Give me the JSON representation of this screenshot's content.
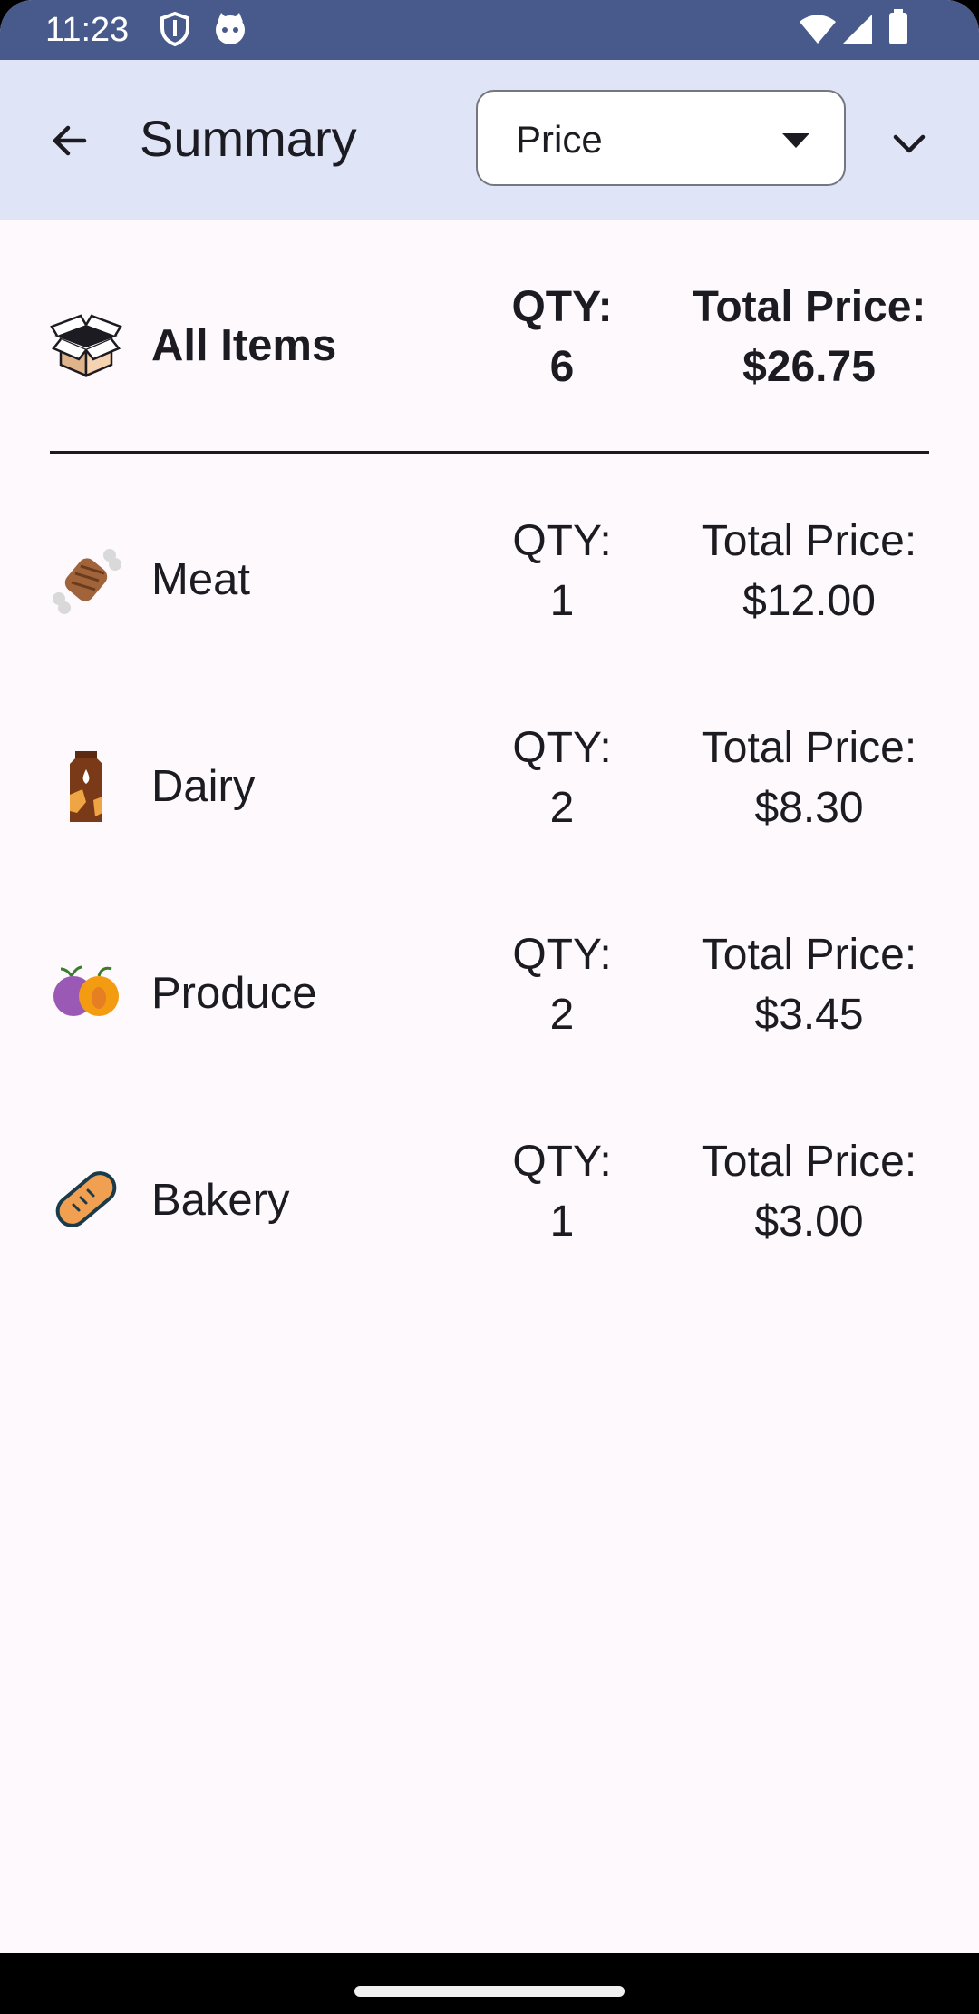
{
  "status_bar": {
    "time": "11:23",
    "icons": [
      "shield-icon",
      "cat-icon",
      "wifi-icon",
      "signal-icon",
      "battery-icon"
    ]
  },
  "app_bar": {
    "back_icon": "arrow-left-icon",
    "title": "Summary",
    "sort_dropdown": {
      "selected": "Price",
      "caret_icon": "caret-down-icon"
    },
    "expand_icon": "chevron-down-icon"
  },
  "summary": {
    "all_items": {
      "icon": "open-box-icon",
      "name": "All Items",
      "qty_label": "QTY:",
      "qty_value": "6",
      "price_label": "Total Price:",
      "price_value": "$26.75"
    },
    "categories": [
      {
        "icon": "meat-icon",
        "name": "Meat",
        "qty_label": "QTY:",
        "qty_value": "1",
        "price_label": "Total Price:",
        "price_value": "$12.00"
      },
      {
        "icon": "milk-carton-icon",
        "name": "Dairy",
        "qty_label": "QTY:",
        "qty_value": "2",
        "price_label": "Total Price:",
        "price_value": "$8.30"
      },
      {
        "icon": "fruit-icon",
        "name": "Produce",
        "qty_label": "QTY:",
        "qty_value": "2",
        "price_label": "Total Price:",
        "price_value": "$3.45"
      },
      {
        "icon": "bread-icon",
        "name": "Bakery",
        "qty_label": "QTY:",
        "qty_value": "1",
        "price_label": "Total Price:",
        "price_value": "$3.00"
      }
    ]
  },
  "colors": {
    "status_bar": "#485a8c",
    "app_bar": "#dfe4f7",
    "background": "#fdf9fd",
    "text": "#1b1b21"
  }
}
